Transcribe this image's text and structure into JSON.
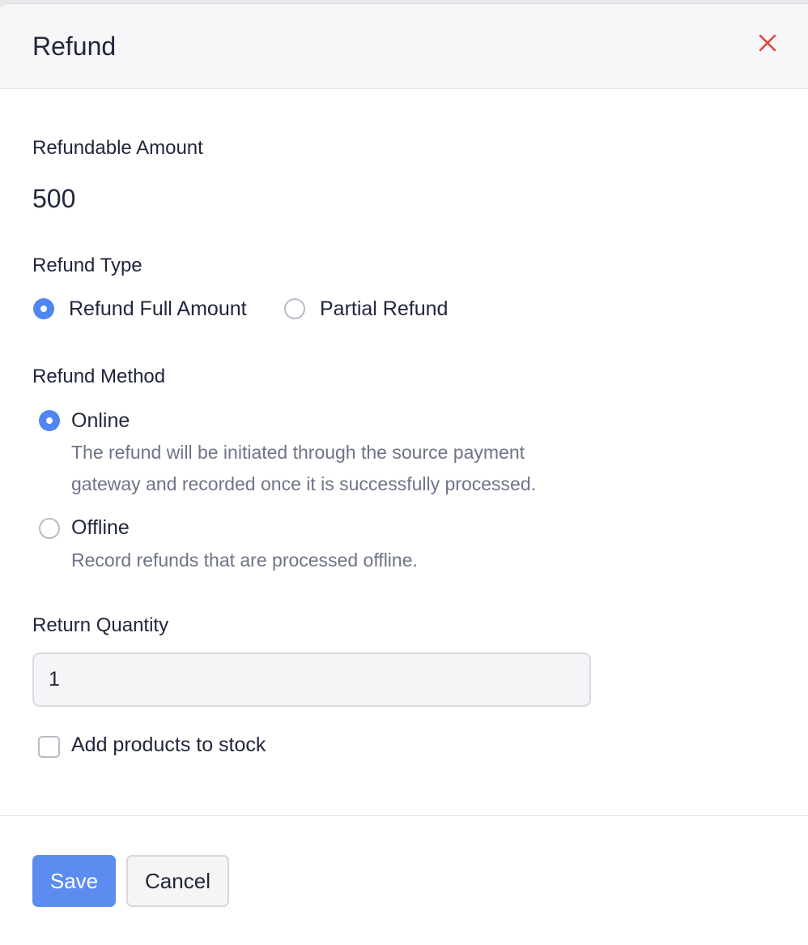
{
  "modal": {
    "title": "Refund"
  },
  "refundable_amount": {
    "label": "Refundable Amount",
    "value": "500"
  },
  "refund_type": {
    "label": "Refund Type",
    "options": [
      {
        "label": "Refund Full Amount",
        "selected": true
      },
      {
        "label": "Partial Refund",
        "selected": false
      }
    ]
  },
  "refund_method": {
    "label": "Refund Method",
    "options": [
      {
        "label": "Online",
        "selected": true,
        "description_line1": "The refund will be initiated through the source payment",
        "description_line2": "gateway and recorded once it is successfully processed."
      },
      {
        "label": "Offline",
        "selected": false,
        "description_line1": "Record refunds that are processed offline."
      }
    ]
  },
  "return_quantity": {
    "label": "Return Quantity",
    "value": "1"
  },
  "stock_checkbox": {
    "label": "Add products to stock",
    "checked": false
  },
  "footer": {
    "save_label": "Save",
    "cancel_label": "Cancel"
  },
  "colors": {
    "accent": "#4f86ef",
    "close_icon": "#e2453c",
    "description_text": "#6e7487"
  },
  "icons": {
    "close": "close-icon"
  }
}
